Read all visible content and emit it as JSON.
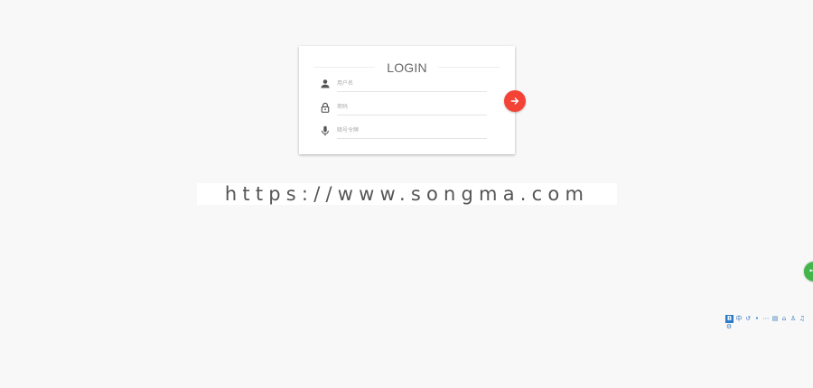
{
  "login": {
    "title": "LOGIN",
    "username_placeholder": "用户名",
    "password_placeholder": "密码",
    "code_placeholder": "暗号令牌"
  },
  "watermark": {
    "text": "https://www.songma.com"
  },
  "icons": {
    "username": "user-icon",
    "password": "lock-icon",
    "code": "microphone-icon",
    "submit": "arrow-right-icon"
  },
  "colors": {
    "background": "#f8f8f8",
    "submit_button": "#f44336",
    "float_button": "#43b54a"
  },
  "ime_toolbar": {
    "items": [
      "中",
      "↺",
      "•",
      "⋯",
      "▤",
      "⌂",
      "♙",
      "♫",
      "⚙"
    ]
  }
}
